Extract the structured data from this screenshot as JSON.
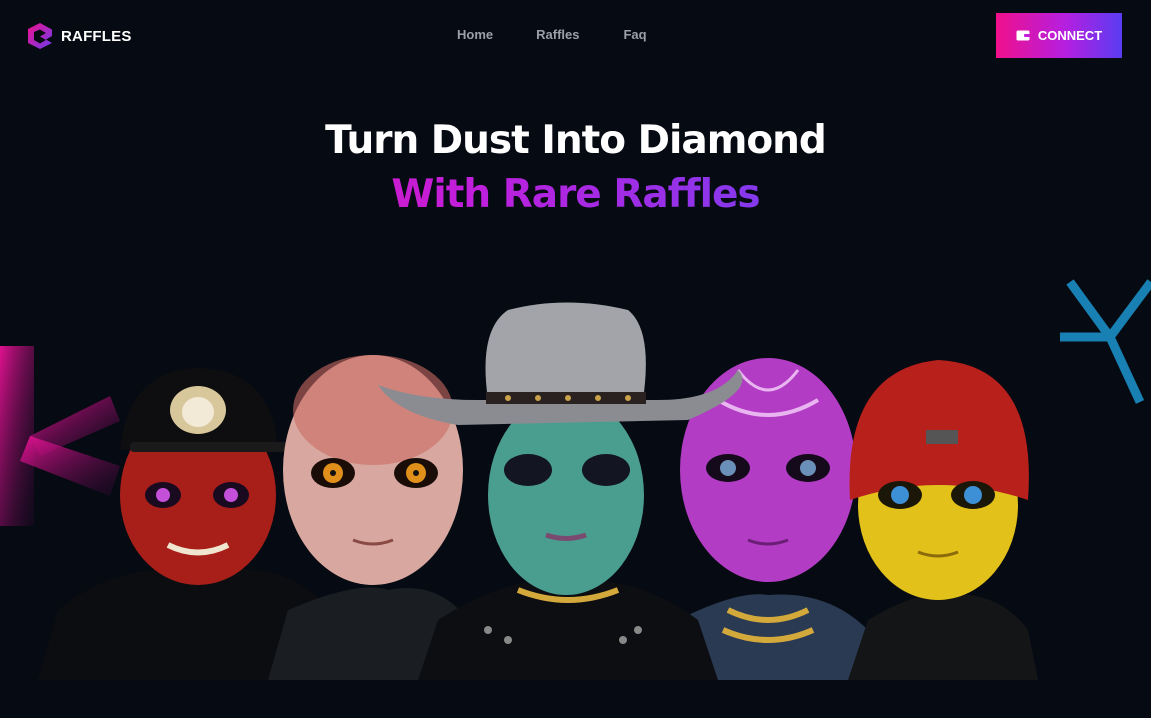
{
  "brand": {
    "name": "RAFFLES",
    "icon": "raffles-logo-icon"
  },
  "nav": {
    "links": [
      "Home",
      "Raffles",
      "Faq"
    ]
  },
  "connect": {
    "label": "CONNECT",
    "icon": "wallet-icon"
  },
  "hero": {
    "line1": "Turn Dust Into Diamond",
    "line2": "With Rare Raffles"
  },
  "avatars": [
    {
      "name": "red-alien-with-black-cap",
      "skin": "#b3221c",
      "eyes": "#c44fd9",
      "hat": "cap"
    },
    {
      "name": "pale-pink-alien",
      "skin": "#e3b7b0",
      "eyes": "#e08a14",
      "hat": "none"
    },
    {
      "name": "teal-alien-with-cowboy-hat",
      "skin": "#4fa395",
      "eyes": "#1b1f2e",
      "hat": "cowboy"
    },
    {
      "name": "purple-alien-with-tattoos",
      "skin": "#b83fc8",
      "eyes": "#5a7ea6",
      "hat": "none"
    },
    {
      "name": "yellow-alien-with-red-beanie",
      "skin": "#e6c51c",
      "eyes": "#3d8fd6",
      "hat": "beanie"
    }
  ],
  "colors": {
    "background": "#060a12",
    "accent_pink": "#f0108c",
    "accent_purple": "#b51fe0",
    "accent_blue": "#2f9bf2"
  }
}
